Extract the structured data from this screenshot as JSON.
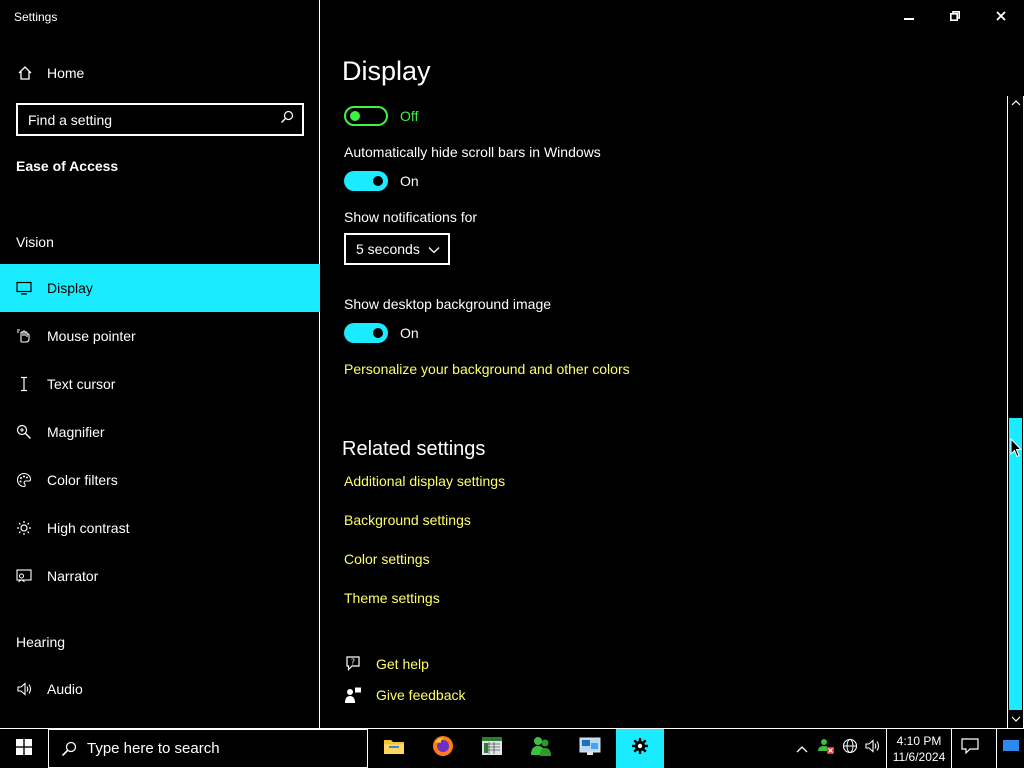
{
  "window": {
    "title": "Settings",
    "minimize_icon": "minimize-icon",
    "restore_icon": "restore-icon",
    "close_icon": "close-icon"
  },
  "sidebar": {
    "home_label": "Home",
    "search_placeholder": "Find a setting",
    "section_title": "Ease of Access",
    "groups": {
      "vision": "Vision",
      "hearing": "Hearing"
    },
    "items": [
      {
        "label": "Display",
        "icon": "monitor-icon",
        "active": true
      },
      {
        "label": "Mouse pointer",
        "icon": "mouse-pointer-icon"
      },
      {
        "label": "Text cursor",
        "icon": "text-cursor-icon"
      },
      {
        "label": "Magnifier",
        "icon": "magnifier-icon"
      },
      {
        "label": "Color filters",
        "icon": "color-filters-icon"
      },
      {
        "label": "High contrast",
        "icon": "high-contrast-icon"
      },
      {
        "label": "Narrator",
        "icon": "narrator-icon"
      },
      {
        "label": "Audio",
        "icon": "audio-icon"
      }
    ]
  },
  "main": {
    "title": "Display",
    "first_toggle": {
      "state": "Off",
      "on": false
    },
    "hide_scrollbars": {
      "label": "Automatically hide scroll bars in Windows",
      "state": "On",
      "on": true
    },
    "notifications": {
      "label": "Show notifications for",
      "value": "5 seconds"
    },
    "desktop_background": {
      "label": "Show desktop background image",
      "state": "On",
      "on": true
    },
    "personalize_link": "Personalize your background and other colors",
    "related": {
      "heading": "Related settings",
      "links": [
        "Additional display settings",
        "Background settings",
        "Color settings",
        "Theme settings"
      ]
    },
    "help": {
      "get_help": "Get help",
      "give_feedback": "Give feedback"
    }
  },
  "taskbar": {
    "search_placeholder": "Type here to search",
    "apps": [
      "file-explorer-icon",
      "firefox-icon",
      "spreadsheet-app-icon",
      "people-app-icon",
      "remote-desktop-icon",
      "settings-gear-icon"
    ],
    "time": "4:10 PM",
    "date": "11/6/2024"
  },
  "colors": {
    "accent": "#1aebff",
    "link": "#ffff66",
    "toggle_off": "#3ff23f",
    "background": "#000000"
  }
}
